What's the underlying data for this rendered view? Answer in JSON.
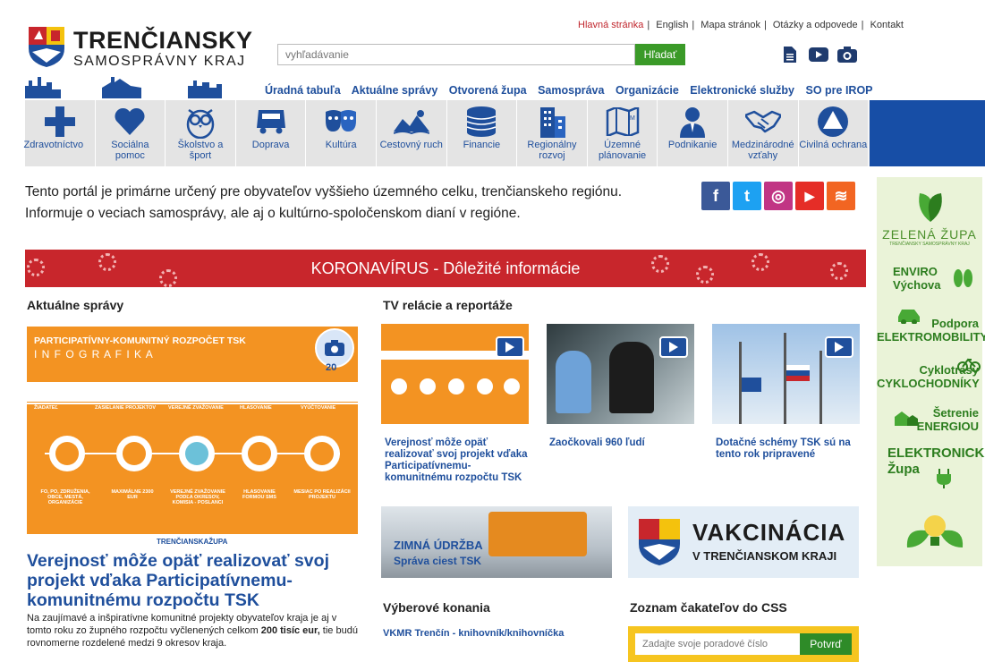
{
  "header": {
    "top_links": [
      "Hlavná stránka",
      "English",
      "Mapa stránok",
      "Otázky a odpovede",
      "Kontakt"
    ],
    "logo_title": "TRENČIANSKY",
    "logo_subtitle": "SAMOSPRÁVNY KRAJ",
    "search_placeholder": "vyhľadávanie",
    "search_button": "Hľadať",
    "icons": [
      "document-icon",
      "youtube-icon",
      "camera-icon"
    ],
    "nav": [
      "Úradná tabuľa",
      "Aktuálne správy",
      "Otvorená župa",
      "Samospráva",
      "Organizácie",
      "Elektronické služby",
      "SO pre IROP"
    ]
  },
  "categories": [
    {
      "label": "Zdravotníctvo",
      "icon": "health-cross-icon"
    },
    {
      "label": "Sociálna pomoc",
      "icon": "heart-icon"
    },
    {
      "label": "Školstvo a šport",
      "icon": "owl-icon"
    },
    {
      "label": "Doprava",
      "icon": "bus-icon"
    },
    {
      "label": "Kultúra",
      "icon": "masks-icon"
    },
    {
      "label": "Cestovný ruch",
      "icon": "landscape-icon"
    },
    {
      "label": "Financie",
      "icon": "coins-icon"
    },
    {
      "label": "Regionálny rozvoj",
      "icon": "buildings-icon"
    },
    {
      "label": "Územné plánovanie",
      "icon": "map-icon"
    },
    {
      "label": "Podnikanie",
      "icon": "businessman-icon"
    },
    {
      "label": "Medzinárodné vzťahy",
      "icon": "handshake-icon"
    },
    {
      "label": "Civilná ochrana",
      "icon": "triangle-icon"
    }
  ],
  "intro": "Tento portál je primárne určený pre obyvateľov vyššieho územného celku, trenčianskeho regiónu. Informuje o veciach samosprávy, ale aj o kultúrno-spoločenskom dianí v regióne.",
  "social": [
    {
      "name": "facebook-icon",
      "glyph": "f",
      "color": "#3b5998"
    },
    {
      "name": "twitter-icon",
      "glyph": "t",
      "color": "#1da1f2"
    },
    {
      "name": "instagram-icon",
      "glyph": "◎",
      "color": "#c13584"
    },
    {
      "name": "youtube-icon",
      "glyph": "▶",
      "color": "#e52d27"
    },
    {
      "name": "rss-icon",
      "glyph": "≋",
      "color": "#f26522"
    }
  ],
  "corona": "KORONAVÍRUS - Dôležité informácie",
  "news": {
    "heading": "Aktuálne správy",
    "image_title": "PARTICIPATÍVNY-KOMUNITNÝ ROZPOČET TSK",
    "image_sub": "I N F O G R A F I K A",
    "photo_count": "20",
    "steps": [
      "ŽIADATEĽ",
      "ZASIELANIE PROJEKTOV",
      "VEREJNÉ ZVAŽOVANIE",
      "HLASOVANIE",
      "VYÚČTOVANIE"
    ],
    "step_texts": [
      "FO, PO, ZDRUŽENIA, OBCE, MESTÁ, ORGANIZÁCIE",
      "MAXIMÁLNE 2300 EUR",
      "VEREJNÉ ZVAŽOVANIE PODĽA OKRESOV, KOMISIA - POSLANCI",
      "HLASOVANIE FORMOU SMS",
      "MESIAC PO REALIZÁCII PROJEKTU"
    ],
    "brand": "TRENČIANSKAŽUPA",
    "title": "Verejnosť môže opäť realizovať svoj projekt vďaka Participatívnemu-komunitnému rozpočtu TSK",
    "body_a": "Na zaujímavé a inšpiratívne komunitné projekty obyvateľov kraja je aj v tomto roku zo župného rozpočtu vyčlenených celkom ",
    "body_bold": "200 tisíc eur,",
    "body_b": " tie budú rovnomerne rozdelené medzi 9 okresov kraja."
  },
  "tv": {
    "heading": "TV relácie a reportáže",
    "items": [
      "Verejnosť môže opäť realizovať svoj projekt vďaka Participatívnemu-komunitnému rozpočtu TSK",
      "Zaočkovali 960 ľudí",
      "Dotačné schémy TSK sú na tento rok pripravené"
    ]
  },
  "banners": {
    "winter_line1": "ZIMNÁ ÚDRŽBA",
    "winter_line2": "Správa ciest TSK",
    "vax_line1": "VAKCINÁCIA",
    "vax_line2": "V TRENČIANSKOM KRAJI"
  },
  "tenders": {
    "heading": "Výberové konania",
    "item": "VKMR Trenčín - knihovník/knihovníčka"
  },
  "css": {
    "heading": "Zoznam čakateľov do CSS",
    "placeholder": "Zadajte svoje poradové číslo",
    "button": "Potvrď"
  },
  "green": {
    "title": "ZELENÁ ŽUPA",
    "subtitle": "TRENČIANSKY SAMOSPRÁVNY KRAJ",
    "items": [
      {
        "l1": "ENVIRO",
        "l2": "Výchova"
      },
      {
        "l1": "Podpora",
        "l2": "ELEKTROMOBILITY"
      },
      {
        "l1": "Cyklotrasy",
        "l2": "CYKLOCHODNÍKY"
      },
      {
        "l1": "Šetrenie",
        "l2": "ENERGIOU"
      },
      {
        "l1": "ELEKTRONICKÁ",
        "l2": "Župa"
      }
    ]
  },
  "colors": {
    "brand_blue": "#1f4f9c",
    "corona_red": "#c8262c",
    "green": "#3a9a28",
    "orange": "#f39322"
  }
}
